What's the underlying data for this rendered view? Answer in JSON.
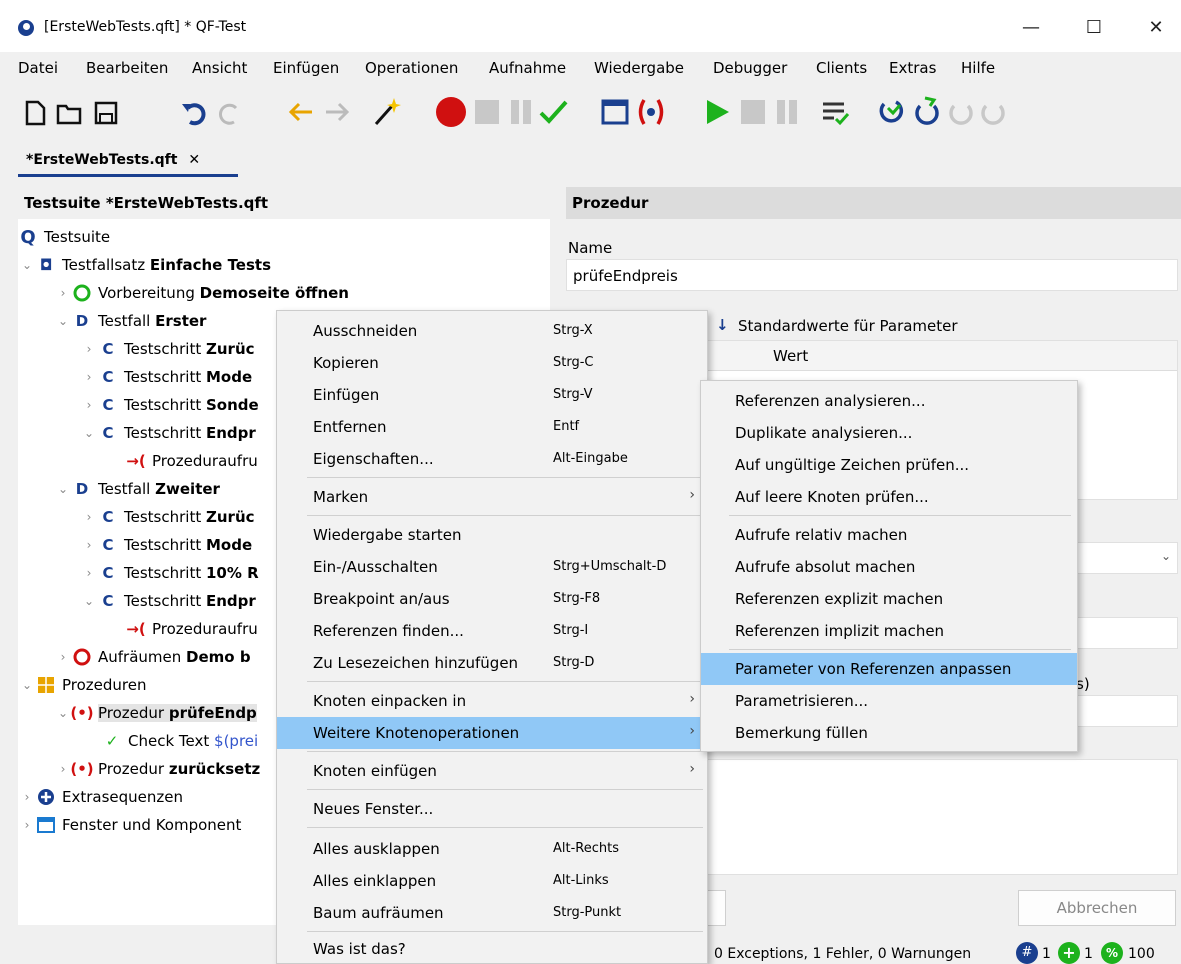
{
  "window": {
    "title": "[ErsteWebTests.qft] * QF-Test",
    "minimize": "—",
    "maximize": "☐",
    "close": "✕"
  },
  "menu": [
    "Datei",
    "Bearbeiten",
    "Ansicht",
    "Einfügen",
    "Operationen",
    "Aufnahme",
    "Wiedergabe",
    "Debugger",
    "Clients",
    "Extras",
    "Hilfe"
  ],
  "tab": {
    "label": "*ErsteWebTests.qft",
    "close": "✕"
  },
  "tree": {
    "header": "Testsuite *ErsteWebTests.qft",
    "rows": [
      {
        "prefix": "Testsuite",
        "name": ""
      },
      {
        "prefix": "Testfallsatz",
        "name": "Einfache Tests"
      },
      {
        "prefix": "Vorbereitung",
        "name": "Demoseite öffnen"
      },
      {
        "prefix": "Testfall",
        "name": "Erster"
      },
      {
        "prefix": "Testschritt",
        "name": "Zurüc"
      },
      {
        "prefix": "Testschritt",
        "name": "Mode"
      },
      {
        "prefix": "Testschritt",
        "name": "Sonde"
      },
      {
        "prefix": "Testschritt",
        "name": "Endpr"
      },
      {
        "prefix": "Prozeduraufru",
        "name": ""
      },
      {
        "prefix": "Testfall",
        "name": "Zweiter"
      },
      {
        "prefix": "Testschritt",
        "name": "Zurüc"
      },
      {
        "prefix": "Testschritt",
        "name": "Mode"
      },
      {
        "prefix": "Testschritt",
        "name": "10% R"
      },
      {
        "prefix": "Testschritt",
        "name": "Endpr"
      },
      {
        "prefix": "Prozeduraufru",
        "name": ""
      },
      {
        "prefix": "Aufräumen",
        "name": "Demo b"
      },
      {
        "prefix": "Prozeduren",
        "name": ""
      },
      {
        "prefix": "Prozedur",
        "name": "prüfeEndp"
      },
      {
        "prefix": "Check Text",
        "name": "",
        "suffix": "$(prei"
      },
      {
        "prefix": "Prozedur",
        "name": "zurücksetz"
      },
      {
        "prefix": "Extrasequenzen",
        "name": ""
      },
      {
        "prefix": "Fenster und Komponent",
        "name": ""
      }
    ]
  },
  "detail": {
    "header": "Prozedur",
    "name_label": "Name",
    "name_value": "prüfeEndpreis",
    "defaults_label": "Standardwerte für Parameter",
    "col_value": "Wert",
    "partial_s": "s)",
    "cancel_button": "Abbrechen"
  },
  "context_menu": [
    {
      "label": "Ausschneiden",
      "shortcut": "Strg-X"
    },
    {
      "label": "Kopieren",
      "shortcut": "Strg-C"
    },
    {
      "label": "Einfügen",
      "shortcut": "Strg-V"
    },
    {
      "label": "Entfernen",
      "shortcut": "Entf"
    },
    {
      "label": "Eigenschaften...",
      "shortcut": "Alt-Eingabe"
    },
    {
      "label": "Marken",
      "shortcut": ""
    },
    {
      "label": "Wiedergabe starten",
      "shortcut": ""
    },
    {
      "label": "Ein-/Ausschalten",
      "shortcut": "Strg+Umschalt-D"
    },
    {
      "label": "Breakpoint an/aus",
      "shortcut": "Strg-F8"
    },
    {
      "label": "Referenzen finden...",
      "shortcut": "Strg-I"
    },
    {
      "label": "Zu Lesezeichen hinzufügen",
      "shortcut": "Strg-D"
    },
    {
      "label": "Knoten einpacken in",
      "shortcut": ""
    },
    {
      "label": "Weitere Knotenoperationen",
      "shortcut": ""
    },
    {
      "label": "Knoten einfügen",
      "shortcut": ""
    },
    {
      "label": "Neues Fenster...",
      "shortcut": ""
    },
    {
      "label": "Alles ausklappen",
      "shortcut": "Alt-Rechts"
    },
    {
      "label": "Alles einklappen",
      "shortcut": "Alt-Links"
    },
    {
      "label": "Baum aufräumen",
      "shortcut": "Strg-Punkt"
    },
    {
      "label": "Was ist das?",
      "shortcut": ""
    }
  ],
  "submenu": [
    "Referenzen analysieren...",
    "Duplikate analysieren...",
    "Auf ungültige Zeichen prüfen...",
    "Auf leere Knoten prüfen...",
    "Aufrufe relativ machen",
    "Aufrufe absolut machen",
    "Referenzen explizit machen",
    "Referenzen implizit machen",
    "Parameter von Referenzen anpassen",
    "Parametrisieren...",
    "Bemerkung füllen"
  ],
  "status": {
    "text": "0 Exceptions, 1 Fehler, 0 Warnungen",
    "count_a": "1",
    "count_b": "1",
    "count_c": "100"
  },
  "colors": {
    "accent": "#1a3f8f",
    "highlight": "#90c8f6",
    "success": "#1db21d",
    "error": "#d01010"
  }
}
